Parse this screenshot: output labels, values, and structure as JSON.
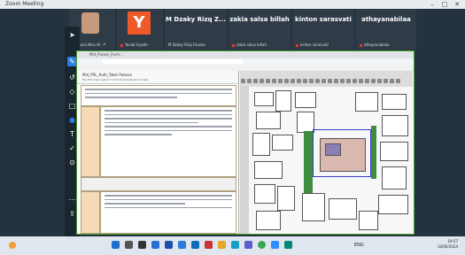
{
  "window": {
    "title": "Zoom Meeting",
    "minimize": "–",
    "maximize": "□",
    "close": "✕"
  },
  "participants": [
    {
      "name": "Farhana Nisa Hi 🎤",
      "type": "photo"
    },
    {
      "name": "Yacob Isyadir",
      "letter": "Y",
      "type": "letter"
    },
    {
      "display": "M Dzaky Rizq Z...",
      "name": "M Dzaky Rizq Fauzan",
      "type": "text"
    },
    {
      "display": "zakia salsa billah",
      "name": "zakia salsa billah",
      "type": "text"
    },
    {
      "display": "kinton sarasvati",
      "name": "kinton sarasvati",
      "type": "text"
    },
    {
      "display": "athayanabilaa",
      "name": "athayanabilaa",
      "type": "text"
    }
  ],
  "browser": {
    "tab": "Mid_Proses_Form...",
    "doc_name": "Mid_PRL_Ruth_Tabel Paduan",
    "menu": "File Edit View Insert Format Tools Extensions Help"
  },
  "taskbar": {
    "time": "19:57",
    "date": "10/06/2024",
    "lang": "ENG"
  },
  "icons": {
    "toolbar": [
      "pointer-icon",
      "pen-icon",
      "undo-icon",
      "eraser-icon",
      "shape-icon",
      "color-icon",
      "text-icon",
      "stamp-icon",
      "save-icon",
      "more-icon",
      "share-icon"
    ],
    "taskbar": [
      "windows-icon",
      "search-icon",
      "taskview-icon",
      "files-icon",
      "word-icon",
      "store-icon",
      "mail-icon",
      "chat-icon",
      "folder-icon",
      "edge-icon",
      "teams-icon",
      "chrome-icon",
      "zoom-icon",
      "meet-icon"
    ]
  }
}
